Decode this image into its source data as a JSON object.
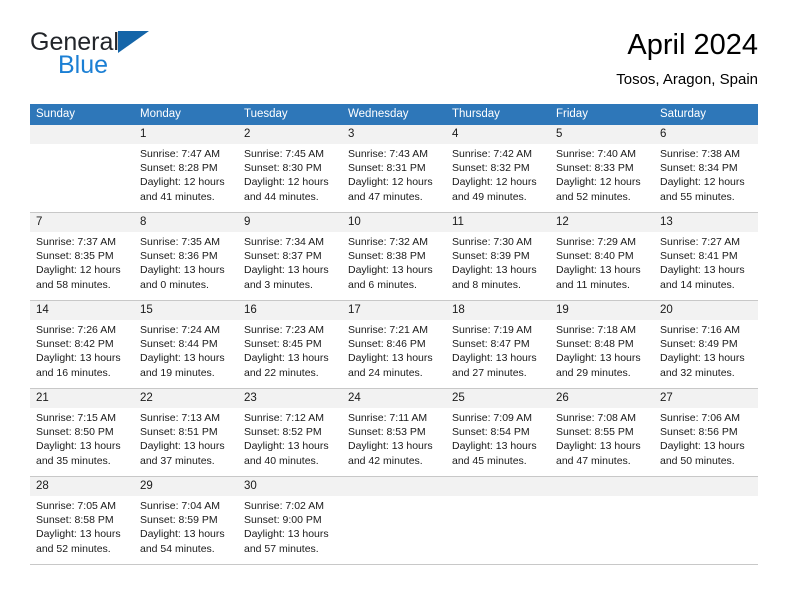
{
  "brand": {
    "line1": "General",
    "line2": "Blue",
    "logo_icon": "blue-triangle-icon"
  },
  "header": {
    "title": "April 2024",
    "subtitle": "Tosos, Aragon, Spain"
  },
  "colors": {
    "header_blue": "#2e77b9",
    "daynum_band": "#f2f2f2",
    "grid_line": "#c8c8c8",
    "brand_blue": "#1b7fd4",
    "logo_triangle": "#1565a8"
  },
  "weekdays": [
    "Sunday",
    "Monday",
    "Tuesday",
    "Wednesday",
    "Thursday",
    "Friday",
    "Saturday"
  ],
  "weeks": [
    [
      {
        "day": "",
        "lines": [
          "",
          "",
          "",
          ""
        ]
      },
      {
        "day": "1",
        "lines": [
          "Sunrise: 7:47 AM",
          "Sunset: 8:28 PM",
          "Daylight: 12 hours",
          "and 41 minutes."
        ]
      },
      {
        "day": "2",
        "lines": [
          "Sunrise: 7:45 AM",
          "Sunset: 8:30 PM",
          "Daylight: 12 hours",
          "and 44 minutes."
        ]
      },
      {
        "day": "3",
        "lines": [
          "Sunrise: 7:43 AM",
          "Sunset: 8:31 PM",
          "Daylight: 12 hours",
          "and 47 minutes."
        ]
      },
      {
        "day": "4",
        "lines": [
          "Sunrise: 7:42 AM",
          "Sunset: 8:32 PM",
          "Daylight: 12 hours",
          "and 49 minutes."
        ]
      },
      {
        "day": "5",
        "lines": [
          "Sunrise: 7:40 AM",
          "Sunset: 8:33 PM",
          "Daylight: 12 hours",
          "and 52 minutes."
        ]
      },
      {
        "day": "6",
        "lines": [
          "Sunrise: 7:38 AM",
          "Sunset: 8:34 PM",
          "Daylight: 12 hours",
          "and 55 minutes."
        ]
      }
    ],
    [
      {
        "day": "7",
        "lines": [
          "Sunrise: 7:37 AM",
          "Sunset: 8:35 PM",
          "Daylight: 12 hours",
          "and 58 minutes."
        ]
      },
      {
        "day": "8",
        "lines": [
          "Sunrise: 7:35 AM",
          "Sunset: 8:36 PM",
          "Daylight: 13 hours",
          "and 0 minutes."
        ]
      },
      {
        "day": "9",
        "lines": [
          "Sunrise: 7:34 AM",
          "Sunset: 8:37 PM",
          "Daylight: 13 hours",
          "and 3 minutes."
        ]
      },
      {
        "day": "10",
        "lines": [
          "Sunrise: 7:32 AM",
          "Sunset: 8:38 PM",
          "Daylight: 13 hours",
          "and 6 minutes."
        ]
      },
      {
        "day": "11",
        "lines": [
          "Sunrise: 7:30 AM",
          "Sunset: 8:39 PM",
          "Daylight: 13 hours",
          "and 8 minutes."
        ]
      },
      {
        "day": "12",
        "lines": [
          "Sunrise: 7:29 AM",
          "Sunset: 8:40 PM",
          "Daylight: 13 hours",
          "and 11 minutes."
        ]
      },
      {
        "day": "13",
        "lines": [
          "Sunrise: 7:27 AM",
          "Sunset: 8:41 PM",
          "Daylight: 13 hours",
          "and 14 minutes."
        ]
      }
    ],
    [
      {
        "day": "14",
        "lines": [
          "Sunrise: 7:26 AM",
          "Sunset: 8:42 PM",
          "Daylight: 13 hours",
          "and 16 minutes."
        ]
      },
      {
        "day": "15",
        "lines": [
          "Sunrise: 7:24 AM",
          "Sunset: 8:44 PM",
          "Daylight: 13 hours",
          "and 19 minutes."
        ]
      },
      {
        "day": "16",
        "lines": [
          "Sunrise: 7:23 AM",
          "Sunset: 8:45 PM",
          "Daylight: 13 hours",
          "and 22 minutes."
        ]
      },
      {
        "day": "17",
        "lines": [
          "Sunrise: 7:21 AM",
          "Sunset: 8:46 PM",
          "Daylight: 13 hours",
          "and 24 minutes."
        ]
      },
      {
        "day": "18",
        "lines": [
          "Sunrise: 7:19 AM",
          "Sunset: 8:47 PM",
          "Daylight: 13 hours",
          "and 27 minutes."
        ]
      },
      {
        "day": "19",
        "lines": [
          "Sunrise: 7:18 AM",
          "Sunset: 8:48 PM",
          "Daylight: 13 hours",
          "and 29 minutes."
        ]
      },
      {
        "day": "20",
        "lines": [
          "Sunrise: 7:16 AM",
          "Sunset: 8:49 PM",
          "Daylight: 13 hours",
          "and 32 minutes."
        ]
      }
    ],
    [
      {
        "day": "21",
        "lines": [
          "Sunrise: 7:15 AM",
          "Sunset: 8:50 PM",
          "Daylight: 13 hours",
          "and 35 minutes."
        ]
      },
      {
        "day": "22",
        "lines": [
          "Sunrise: 7:13 AM",
          "Sunset: 8:51 PM",
          "Daylight: 13 hours",
          "and 37 minutes."
        ]
      },
      {
        "day": "23",
        "lines": [
          "Sunrise: 7:12 AM",
          "Sunset: 8:52 PM",
          "Daylight: 13 hours",
          "and 40 minutes."
        ]
      },
      {
        "day": "24",
        "lines": [
          "Sunrise: 7:11 AM",
          "Sunset: 8:53 PM",
          "Daylight: 13 hours",
          "and 42 minutes."
        ]
      },
      {
        "day": "25",
        "lines": [
          "Sunrise: 7:09 AM",
          "Sunset: 8:54 PM",
          "Daylight: 13 hours",
          "and 45 minutes."
        ]
      },
      {
        "day": "26",
        "lines": [
          "Sunrise: 7:08 AM",
          "Sunset: 8:55 PM",
          "Daylight: 13 hours",
          "and 47 minutes."
        ]
      },
      {
        "day": "27",
        "lines": [
          "Sunrise: 7:06 AM",
          "Sunset: 8:56 PM",
          "Daylight: 13 hours",
          "and 50 minutes."
        ]
      }
    ],
    [
      {
        "day": "28",
        "lines": [
          "Sunrise: 7:05 AM",
          "Sunset: 8:58 PM",
          "Daylight: 13 hours",
          "and 52 minutes."
        ]
      },
      {
        "day": "29",
        "lines": [
          "Sunrise: 7:04 AM",
          "Sunset: 8:59 PM",
          "Daylight: 13 hours",
          "and 54 minutes."
        ]
      },
      {
        "day": "30",
        "lines": [
          "Sunrise: 7:02 AM",
          "Sunset: 9:00 PM",
          "Daylight: 13 hours",
          "and 57 minutes."
        ]
      },
      {
        "day": "",
        "lines": [
          "",
          "",
          "",
          ""
        ]
      },
      {
        "day": "",
        "lines": [
          "",
          "",
          "",
          ""
        ]
      },
      {
        "day": "",
        "lines": [
          "",
          "",
          "",
          ""
        ]
      },
      {
        "day": "",
        "lines": [
          "",
          "",
          "",
          ""
        ]
      }
    ]
  ]
}
